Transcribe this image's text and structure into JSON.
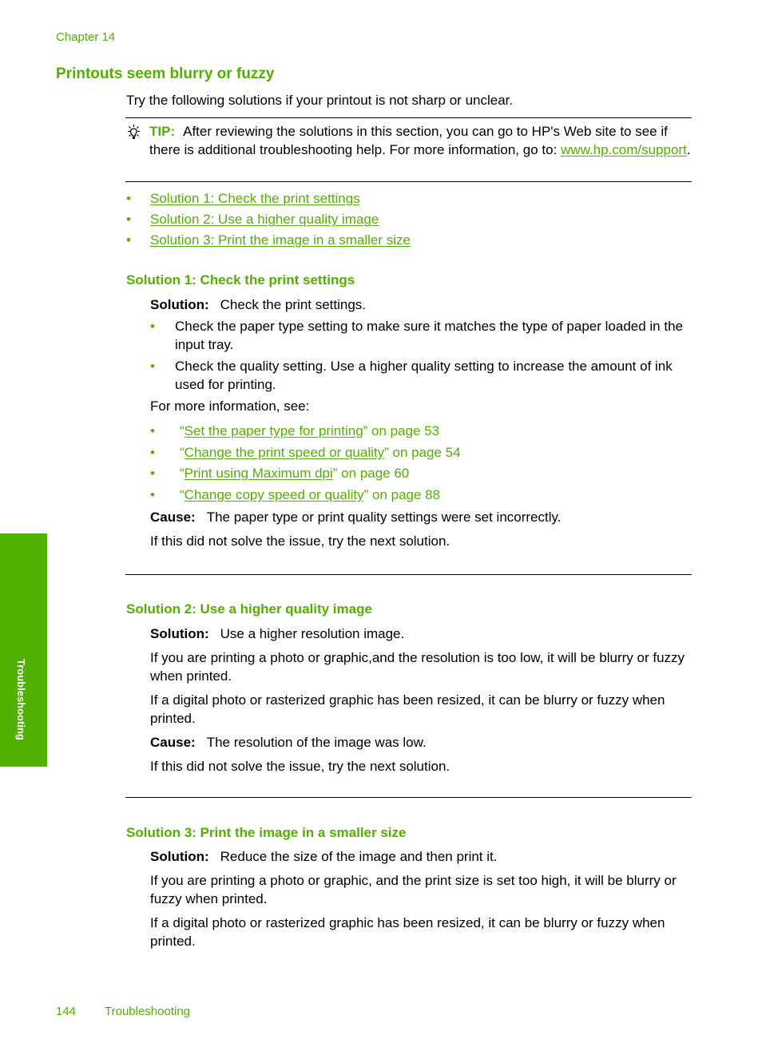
{
  "header": {
    "chapter": "Chapter 14"
  },
  "title": "Printouts seem blurry or fuzzy",
  "intro": "Try the following solutions if your printout is not sharp or unclear.",
  "tip": {
    "icon": "lightbulb-icon",
    "label": "TIP:",
    "text": "After reviewing the solutions in this section, you can go to HP's Web site to see if there is additional troubleshooting help. For more information, go to: ",
    "link": "www.hp.com/support",
    "trailing": "."
  },
  "toc": [
    "Solution 1: Check the print settings",
    "Solution 2: Use a higher quality image",
    "Solution 3: Print the image in a smaller size"
  ],
  "solution1": {
    "heading": "Solution 1: Check the print settings",
    "solution_label": "Solution:",
    "solution_text": "Check the print settings.",
    "bullets": [
      "Check the paper type setting to make sure it matches the type of paper loaded in the input tray.",
      "Check the quality setting. Use a higher quality setting to increase the amount of ink used for printing."
    ],
    "more_info": "For more information, see:",
    "refs": [
      {
        "open": "“",
        "link": "Set the paper type for printing",
        "tail": "” on page 53"
      },
      {
        "open": "“",
        "link": "Change the print speed or quality",
        "tail": "” on page 54"
      },
      {
        "open": "“",
        "link": "Print using Maximum dpi",
        "tail": "” on page 60"
      },
      {
        "open": "“",
        "link": "Change copy speed or quality",
        "tail": "” on page 88"
      }
    ],
    "cause_label": "Cause:",
    "cause_text": "The paper type or print quality settings were set incorrectly.",
    "next": "If this did not solve the issue, try the next solution."
  },
  "solution2": {
    "heading": "Solution 2: Use a higher quality image",
    "solution_label": "Solution:",
    "solution_text": "Use a higher resolution image.",
    "para1": "If you are printing a photo or graphic,and the resolution is too low, it will be blurry or fuzzy when printed.",
    "para2": "If a digital photo or rasterized graphic has been resized, it can be blurry or fuzzy when printed.",
    "cause_label": "Cause:",
    "cause_text": "The resolution of the image was low.",
    "next": "If this did not solve the issue, try the next solution."
  },
  "solution3": {
    "heading": "Solution 3: Print the image in a smaller size",
    "solution_label": "Solution:",
    "solution_text": "Reduce the size of the image and then print it.",
    "para1": "If you are printing a photo or graphic, and the print size is set too high, it will be blurry or fuzzy when printed.",
    "para2": "If a digital photo or rasterized graphic has been resized, it can be blurry or fuzzy when printed."
  },
  "side_tab": {
    "label": "Troubleshooting"
  },
  "footer": {
    "page_number": "144",
    "section": "Troubleshooting"
  },
  "colors": {
    "accent": "#52b000",
    "text": "#000000"
  }
}
